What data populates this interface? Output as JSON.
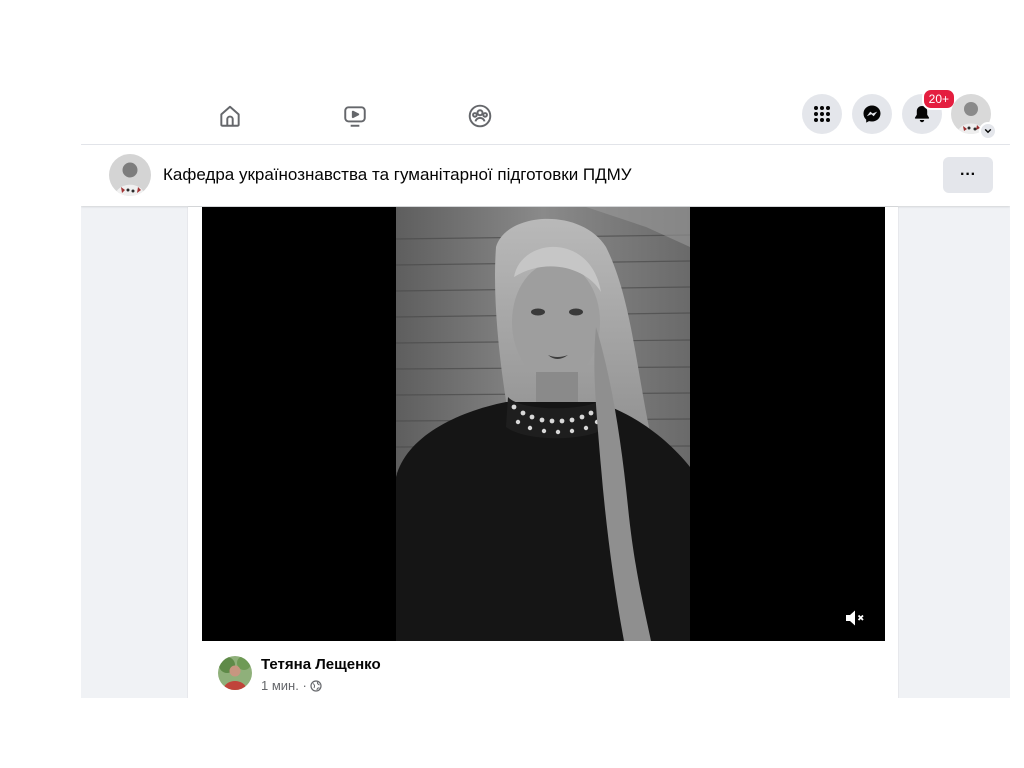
{
  "topbar": {
    "tabs": [
      {
        "name": "home",
        "icon": "home-icon"
      },
      {
        "name": "watch",
        "icon": "video-icon"
      },
      {
        "name": "groups",
        "icon": "groups-icon"
      }
    ],
    "notifications_badge": "20+",
    "icons": [
      "menu-grid-icon",
      "messenger-icon",
      "bell-icon"
    ]
  },
  "page_header": {
    "title": "Кафедра українознавства та гуманітарної підготовки ПДМУ",
    "more_label": "···"
  },
  "post": {
    "author": "Тетяна Лещенко",
    "time": "1 мин. ·",
    "privacy_icon": "globe-icon",
    "video_icons": [
      "volume-muted-icon"
    ]
  },
  "colors": {
    "accent": "#1877f2",
    "badge": "#e41e3f",
    "background": "#f0f2f5",
    "icon": "#65676b"
  }
}
